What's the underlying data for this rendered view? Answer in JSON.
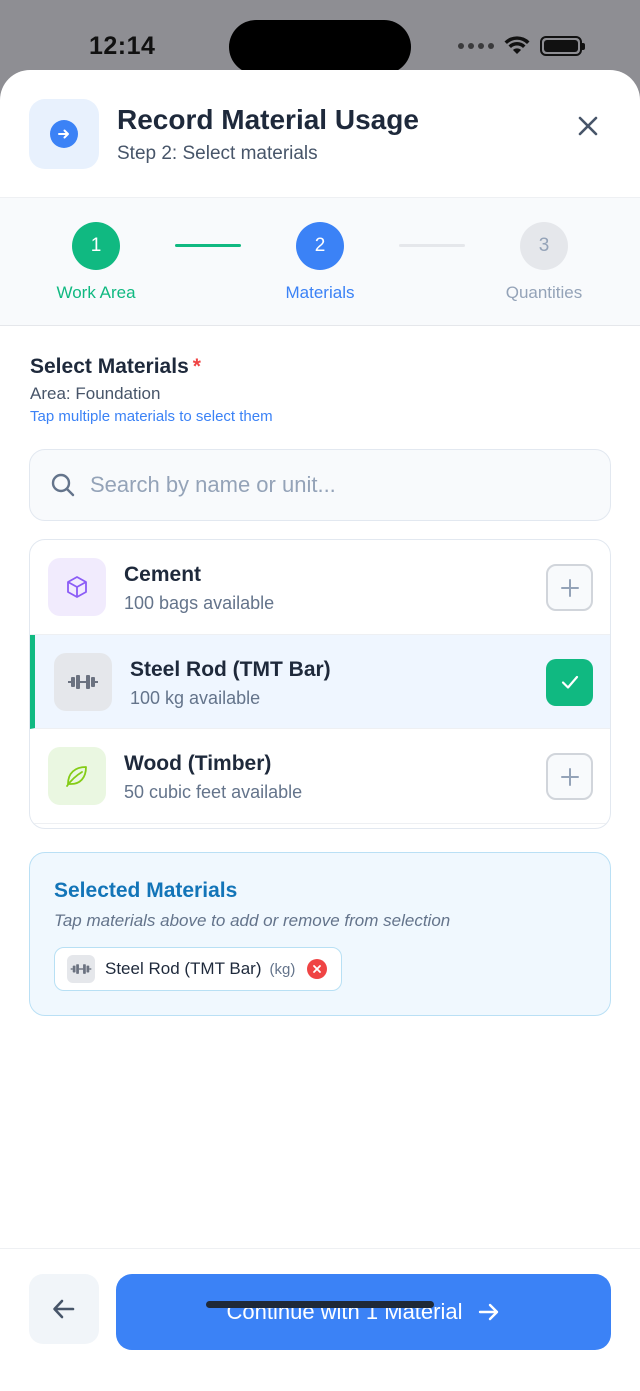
{
  "status_bar": {
    "time": "12:14"
  },
  "header": {
    "title": "Record Material Usage",
    "subtitle": "Step 2: Select materials",
    "icon": "arrow-right-circle-icon",
    "close_icon": "close-icon"
  },
  "stepper": {
    "steps": [
      {
        "number": "1",
        "label": "Work Area",
        "state": "complete"
      },
      {
        "number": "2",
        "label": "Materials",
        "state": "active"
      },
      {
        "number": "3",
        "label": "Quantities",
        "state": "pending"
      }
    ]
  },
  "section": {
    "title": "Select Materials",
    "required_mark": "*",
    "area": "Area: Foundation",
    "hint": "Tap multiple materials to select them"
  },
  "search": {
    "placeholder": "Search by name or unit...",
    "value": ""
  },
  "materials": [
    {
      "name": "Cement",
      "availability": "100 bags available",
      "icon": "cube-icon",
      "selected": false
    },
    {
      "name": "Steel Rod (TMT Bar)",
      "availability": "100 kg available",
      "icon": "dumbbell-icon",
      "selected": true
    },
    {
      "name": "Wood (Timber)",
      "availability": "50 cubic feet available",
      "icon": "leaf-icon",
      "selected": false
    }
  ],
  "selected_panel": {
    "title": "Selected Materials",
    "hint": "Tap materials above to add or remove from selection",
    "chips": [
      {
        "name": "Steel Rod (TMT Bar)",
        "unit": "(kg)"
      }
    ]
  },
  "footer": {
    "continue_label": "Continue with 1 Material"
  },
  "colors": {
    "primary": "#3b82f6",
    "success": "#10b981",
    "danger": "#ef4444"
  }
}
